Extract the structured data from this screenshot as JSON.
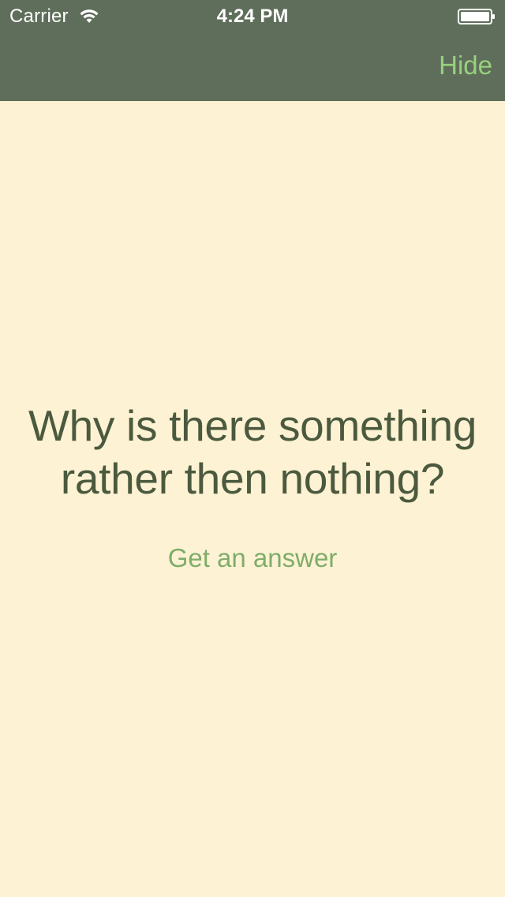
{
  "status_bar": {
    "carrier": "Carrier",
    "time": "4:24 PM",
    "wifi_icon": "wifi-icon",
    "battery_icon": "battery-icon"
  },
  "nav": {
    "hide_label": "Hide"
  },
  "main": {
    "question": "Why is there something rather then nothing?",
    "answer_button_label": "Get an answer"
  },
  "colors": {
    "background": "#fdf2d3",
    "nav_background": "#5f6e5a",
    "nav_button": "#98d17f",
    "question_text": "#4b5a3e",
    "answer_button": "#7fad6a"
  }
}
